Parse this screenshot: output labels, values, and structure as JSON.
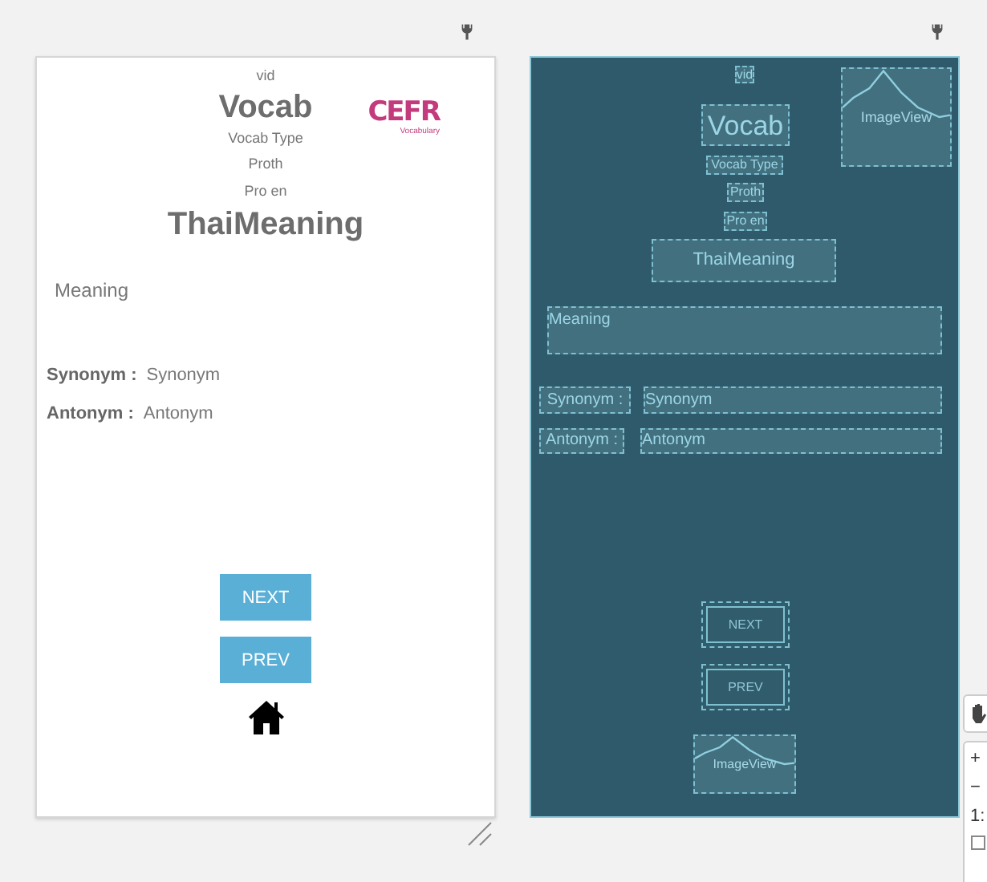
{
  "design": {
    "vid": "vid",
    "title": "Vocab",
    "logo": {
      "letters": "CEFR",
      "caption": "Vocabulary"
    },
    "vocab_type": "Vocab Type",
    "proth": "Proth",
    "pro_en": "Pro en",
    "thai_meaning": "ThaiMeaning",
    "meaning": "Meaning",
    "rows": [
      {
        "label": "Synonym :",
        "value": "Synonym"
      },
      {
        "label": "Antonym :",
        "value": "Antonym"
      }
    ],
    "buttons": [
      "NEXT",
      "PREV"
    ]
  },
  "blueprint": {
    "widgets": [
      {
        "kind": "text",
        "text": "vid"
      },
      {
        "kind": "text",
        "text": "Vocab"
      },
      {
        "kind": "image",
        "text": "ImageView"
      },
      {
        "kind": "text",
        "text": "Vocab Type"
      },
      {
        "kind": "text",
        "text": "Proth"
      },
      {
        "kind": "text",
        "text": "Pro en"
      },
      {
        "kind": "text",
        "text": "ThaiMeaning"
      },
      {
        "kind": "text",
        "text": "Meaning"
      },
      {
        "kind": "text",
        "text": "Synonym :"
      },
      {
        "kind": "text",
        "text": "Synonym"
      },
      {
        "kind": "text",
        "text": "Antonym :"
      },
      {
        "kind": "text",
        "text": "Antonym"
      },
      {
        "kind": "button",
        "text": "NEXT"
      },
      {
        "kind": "button",
        "text": "PREV"
      },
      {
        "kind": "image",
        "text": "ImageView"
      }
    ]
  },
  "zoom_toolbar": [
    "+",
    "−",
    "1:"
  ]
}
